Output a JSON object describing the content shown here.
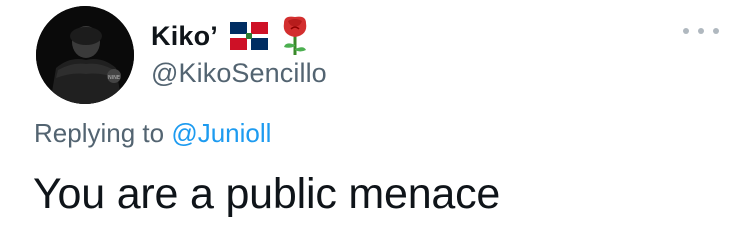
{
  "author": {
    "display_name": "Kiko’",
    "handle": "@KikoSencillo",
    "name_emojis": [
      "dominican-flag-icon",
      "rose-icon"
    ]
  },
  "reply_context": {
    "prefix": "Replying to",
    "mention": "@Junioll"
  },
  "tweet": {
    "text": "You are a public menace"
  },
  "more_menu": {
    "icon": "more-horizontal-icon"
  },
  "colors": {
    "primary_text": "#0f1419",
    "secondary_text": "#536471",
    "link": "#1d9bf0",
    "more_dots": "#b0b8bf"
  }
}
